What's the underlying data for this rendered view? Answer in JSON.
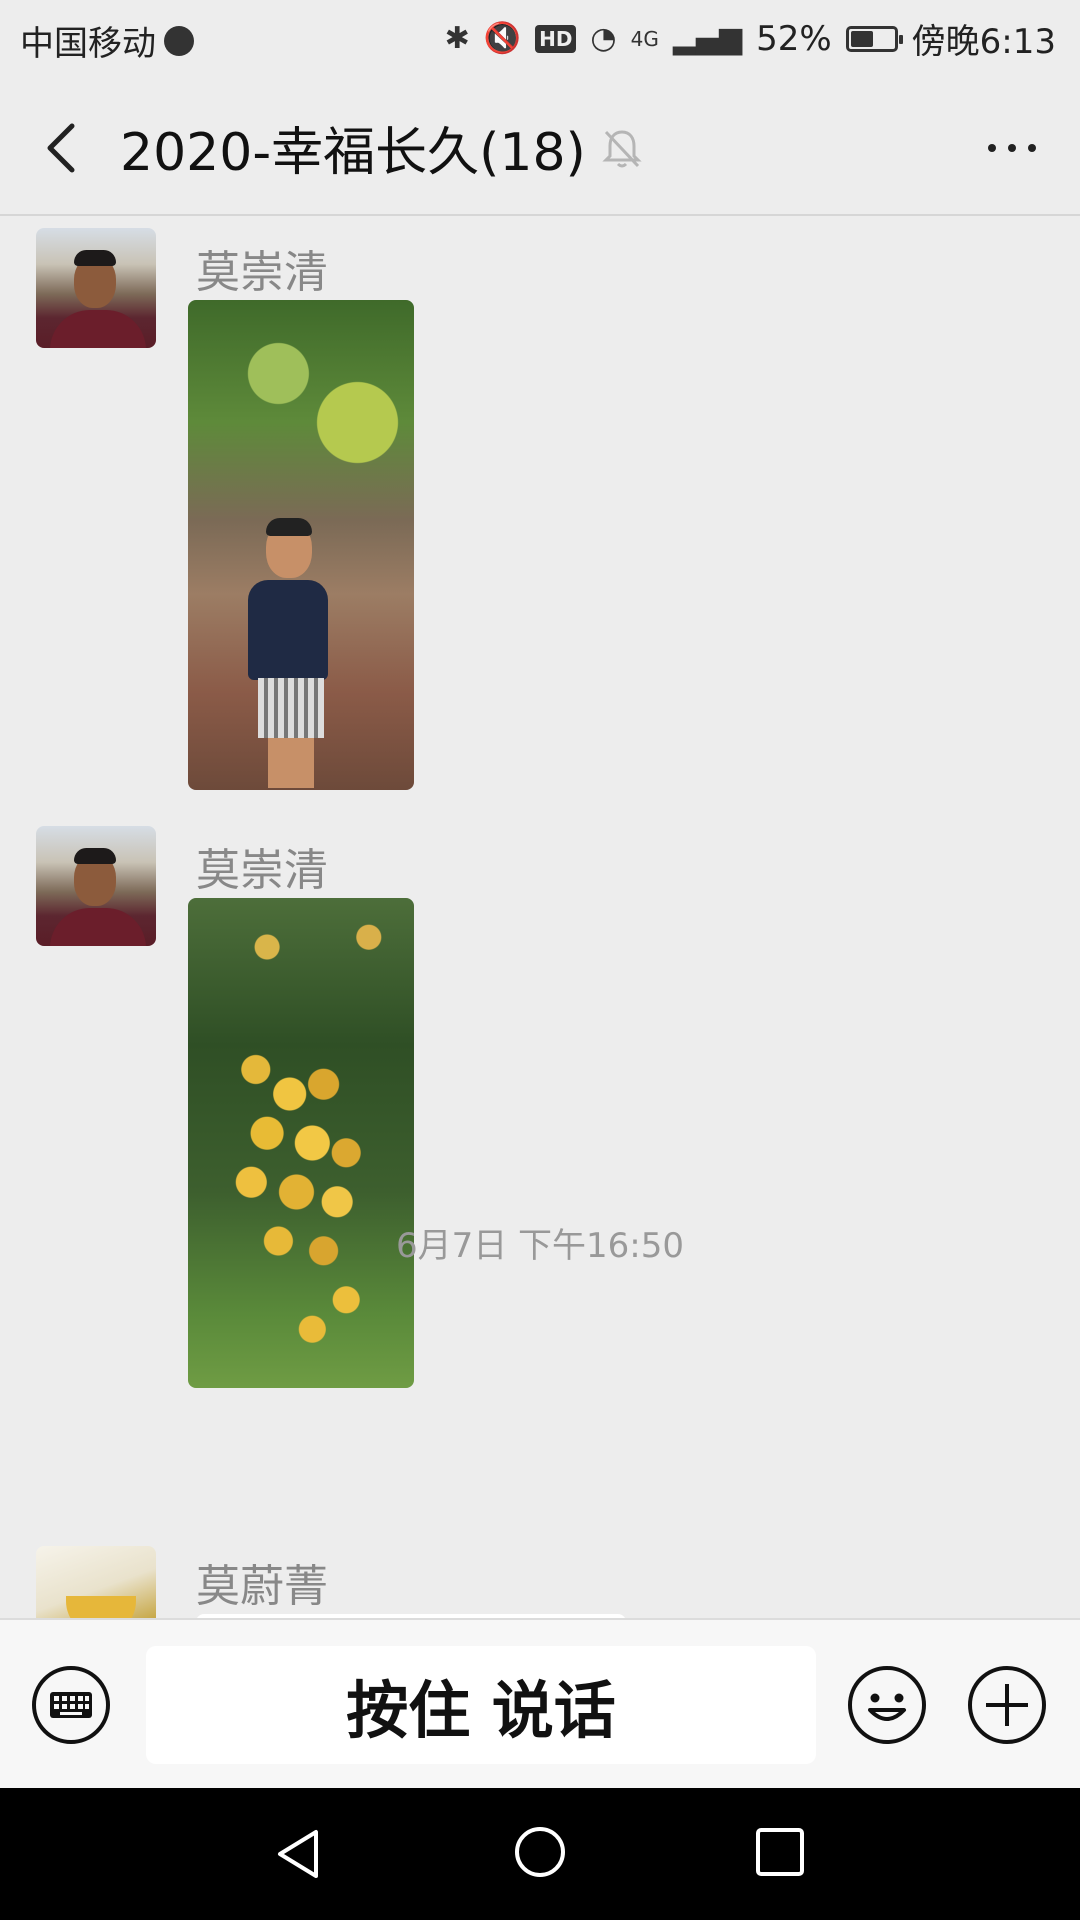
{
  "status_bar": {
    "carrier": "中国移动",
    "hd": "HD",
    "network": "4G",
    "battery_percent": "52%",
    "battery_level": 0.52,
    "time": "傍晚6:13"
  },
  "header": {
    "title": "2020-幸福长久(18)",
    "back_icon": "back-icon",
    "mute_icon": "bell-off-icon",
    "more_icon": "more-icon"
  },
  "messages": [
    {
      "sender": "莫崇清",
      "type": "image",
      "image_desc_icon": "photo"
    },
    {
      "sender": "莫崇清",
      "type": "image",
      "image_desc_icon": "photo"
    },
    {
      "sender": "莫蔚菁",
      "type": "partial"
    }
  ],
  "timestamp": "6月7日 下午16:50",
  "input_bar": {
    "hold_to_talk": "按住 说话",
    "keyboard_icon": "keyboard-icon",
    "emoji_icon": "emoji-icon",
    "plus_icon": "plus-icon"
  },
  "nav_bar": {
    "back": "nav-back-icon",
    "home": "nav-home-icon",
    "recent": "nav-recent-icon"
  },
  "colors": {
    "background": "#ededed",
    "sender_name": "#888888",
    "input_bar": "#f7f7f7"
  }
}
